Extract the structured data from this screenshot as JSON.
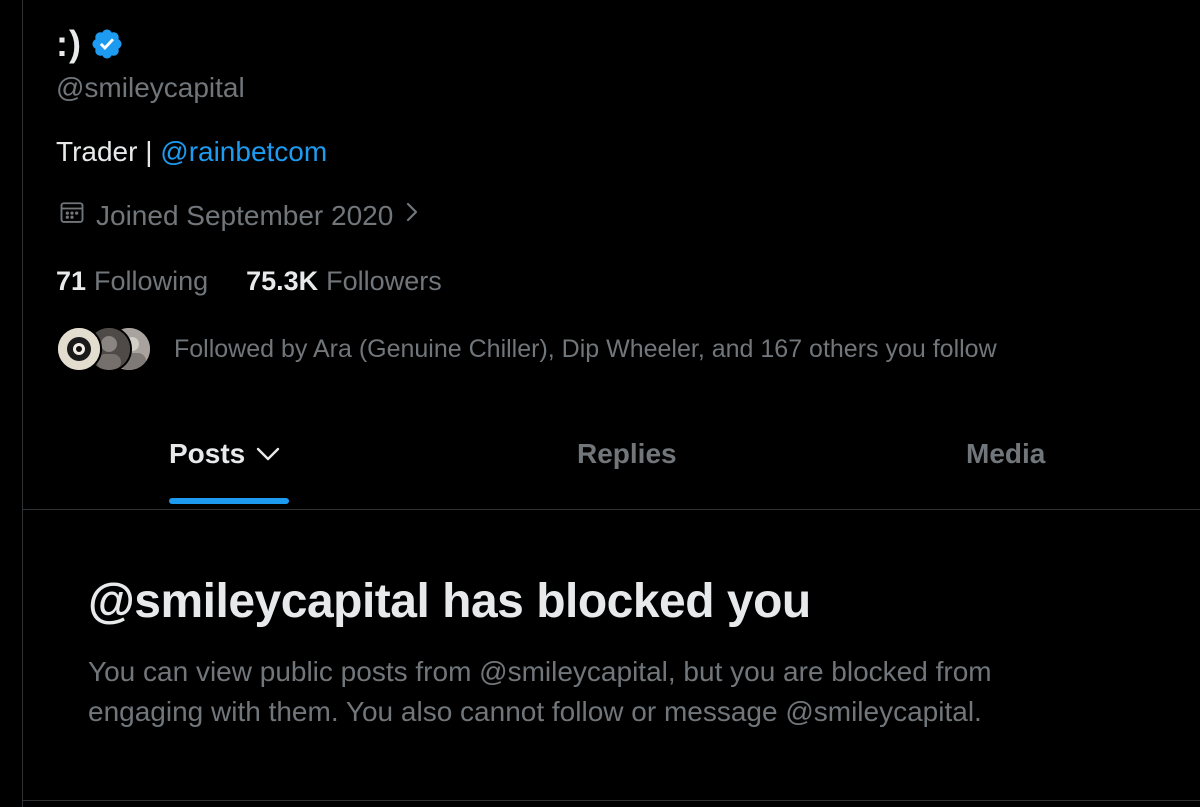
{
  "profile": {
    "display_name": ":)",
    "verified_icon": "verified-badge-icon",
    "handle": "@smileycapital",
    "bio_text": "Trader | ",
    "bio_mention": "@rainbetcom",
    "joined": "Joined September 2020",
    "following_count": "71",
    "following_label": "Following",
    "followers_count": "75.3K",
    "followers_label": "Followers",
    "followed_by": "Followed by Ara (Genuine Chiller), Dip Wheeler, and 167 others you follow"
  },
  "tabs": [
    {
      "label": "Posts",
      "active": true
    },
    {
      "label": "Replies",
      "active": false
    },
    {
      "label": "Media",
      "active": false
    }
  ],
  "blocked": {
    "title": "@smileycapital has blocked you",
    "body": "You can view public posts from @smileycapital, but you are blocked from engaging with them. You also cannot follow or message @smileycapital."
  },
  "colors": {
    "background": "#000000",
    "primary_text": "#e7e9ea",
    "secondary_text": "#71767b",
    "accent": "#1d9bf0",
    "divider": "#2f3336"
  }
}
